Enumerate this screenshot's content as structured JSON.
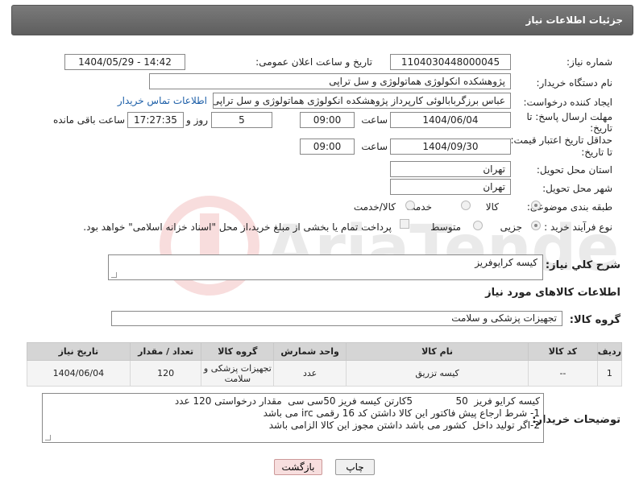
{
  "header": {
    "title": "جزئیات اطلاعات نیاز"
  },
  "form": {
    "need_number_label": "شماره نیاز:",
    "need_number": "1104030448000045",
    "announce_label": "تاریخ و ساعت اعلان عمومی:",
    "announce_value": "1404/05/29 - 14:42",
    "buyer_org_label": "نام دستگاه خریدار:",
    "buyer_org": "پژوهشکده انکولوژی هماتولوژی و سل تراپی",
    "requester_label": "ایجاد کننده درخواست:",
    "requester": "عباس برزگربابالوئی کارپرداز پژوهشکده انکولوژی هماتولوژی و سل تراپی",
    "contact_link": "اطلاعات تماس خریدار",
    "deadline_label_1": "مهلت ارسال پاسخ: تا",
    "deadline_label_2": "تاریخ:",
    "deadline_date": "1404/06/04",
    "time_label": "ساعت",
    "deadline_time": "09:00",
    "days_value": "5",
    "days_label": "روز و",
    "remaining_time": "17:27:35",
    "remaining_label": "ساعت باقی مانده",
    "min_validity_label_1": "حداقل تاریخ اعتبار قیمت:",
    "min_validity_label_2": "تا تاریخ:",
    "validity_date": "1404/09/30",
    "validity_time": "09:00",
    "province_label": "استان محل تحویل:",
    "province": "تهران",
    "city_label": "شهر محل تحویل:",
    "city": "تهران",
    "category_label": "طبقه بندی موضوعی:",
    "category_options": [
      "کالا",
      "خدمت",
      "کالا/خدمت"
    ],
    "process_label": "نوع فرآیند خرید :",
    "process_options": [
      "جزیی",
      "متوسط"
    ],
    "payment_note": "پرداخت تمام یا بخشی از مبلغ خرید،از محل \"اسناد خزانه اسلامی\" خواهد بود.",
    "description_label": "شرح كلي نياز:",
    "description": "کیسه کرایوفریز"
  },
  "goods": {
    "section_title": "اطلاعات کالاهای مورد نیاز",
    "group_label": "گروه کالا:",
    "group_value": "تجهیزات پزشکی و سلامت",
    "columns": [
      "ردیف",
      "کد کالا",
      "نام کالا",
      "واحد شمارش",
      "گروه کالا",
      "تعداد / مقدار",
      "تاریخ نیاز"
    ],
    "rows": [
      {
        "row": "1",
        "code": "--",
        "name": "کیسه تزریق",
        "unit": "عدد",
        "group": "تجهیزات پزشکی و سلامت",
        "qty": "120",
        "date": "1404/06/04"
      }
    ]
  },
  "buyer_notes": {
    "label": "توضیحات خریدار:",
    "text": "کیسه کرایو فریز  50              5کارتن کیسه فریز 50سی سی  مقدار درخواستی 120 عدد\n1- شرط ارجاع پیش فاکتور این کالا داشتن کد 16 رقمی irc می باشد\n2-اگر تولید داخل  کشور می باشد داشتن مجوز این کالا الزامی باشد"
  },
  "buttons": {
    "print": "چاپ",
    "back": "بازگشت"
  },
  "watermark": {
    "text": "AriaTender.net"
  }
}
